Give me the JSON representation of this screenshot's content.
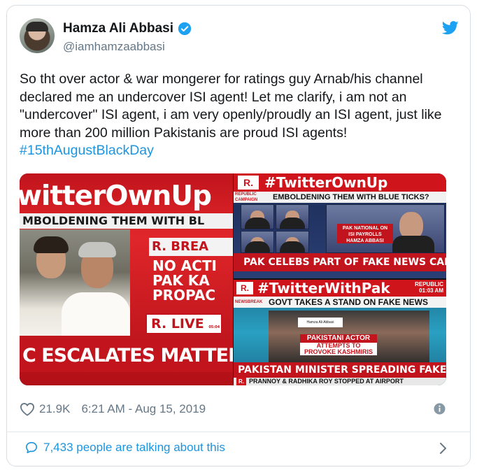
{
  "tweet": {
    "display_name": "Hamza Ali Abbasi",
    "handle": "@iamhamzaabbasi",
    "text": "So tht over actor & war mongerer for ratings guy Arnab/his channel declared me an undercover ISI agent! Let me clarify, i am not an \"undercover\" ISI agent, i am very openly/proudly an ISI agent, just like more than 200 million Pakistanis are proud ISI agents! ",
    "hashtag": "#15thAugustBlackDay",
    "likes": "21.9K",
    "timestamp": "6:21 AM - Aug 15, 2019",
    "talking": "7,433 people are talking about this"
  },
  "media": {
    "left": {
      "banner": "witterOwnUp",
      "subbar": "MBOLDENING THEM WITH BL",
      "breaking": "R. BREA",
      "body_lines": [
        "NO ACTI",
        "PAK KA",
        "PROPAC"
      ],
      "live_r": "R.",
      "live": "LIVE",
      "live_time": "05:04 PM",
      "bottom": "C ESCALATES MATTER WIT"
    },
    "right_top": {
      "logo": "R.",
      "banner": "#TwitterOwnUp",
      "tiny_tag": "REPUBLIC CAMPAIGN",
      "subbar": "EMBOLDENING THEM WITH BLUE TICKS?",
      "pak_label": "PAK NATIONAL ON ISI PAYROLLS HAMZA ABBASI",
      "bottom": "PAK CELEBS PART OF FAKE NEWS CAMPAIGN"
    },
    "right_bottom": {
      "logo": "R.",
      "banner": "#TwitterWithPak",
      "republic": "REPUBLIC",
      "republic_time": "01:03 AM",
      "newsbreak": "NEWSBREAK",
      "subbar": "GOVT TAKES A STAND ON FAKE NEWS",
      "inner_label": "Hamza Ali Abbasi",
      "actor_l1": "PAKISTANI ACTOR",
      "actor_l2": "ATTEMPTS TO",
      "actor_l3": "PROVOKE KASHMIRIS",
      "bottom": "PAKISTAN MINISTER SPREADING FAKE NEWS",
      "ticker_r": "R.",
      "ticker": "PRANNOY & RADHIKA ROY STOPPED AT AIRPORT"
    }
  },
  "colors": {
    "accent": "#1b95e0",
    "muted": "#657786",
    "twitter_blue": "#1da1f2",
    "republic_red": "#c1141c"
  }
}
